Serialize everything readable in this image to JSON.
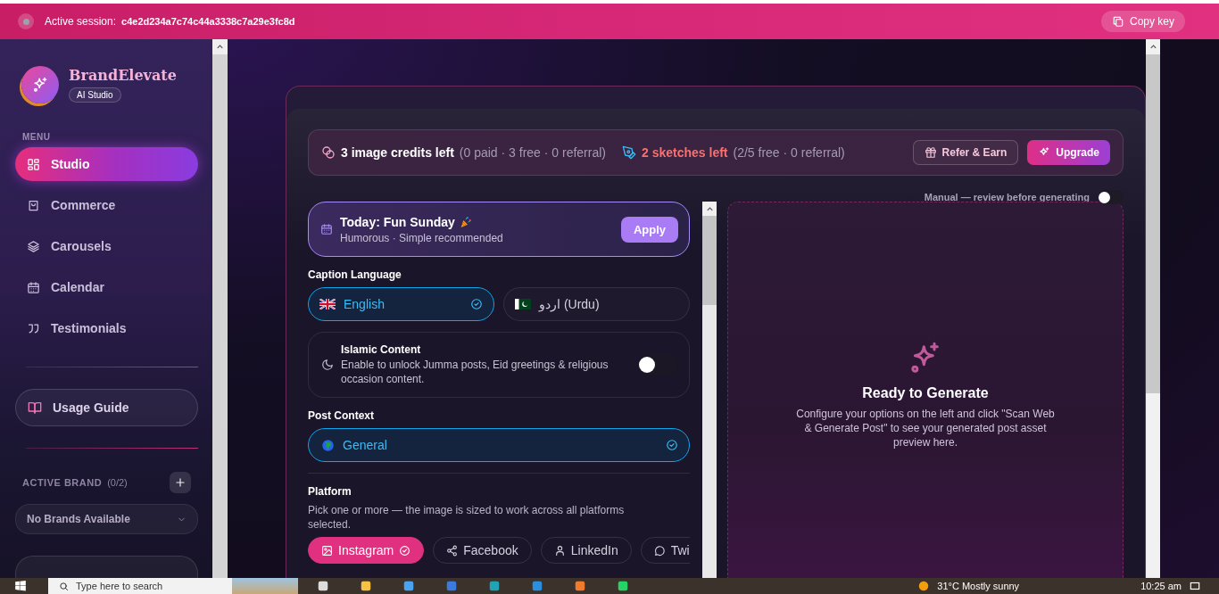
{
  "session_bar": {
    "label": "Active session:",
    "session_id": "c4e2d234a7c74c44a3338c7a29e3fc8d",
    "copy_button": "Copy key"
  },
  "sidebar": {
    "brand": {
      "name": "BrandElevate",
      "badge": "AI Studio"
    },
    "menu_heading": "MENU",
    "items": [
      {
        "label": "Studio",
        "selected": true
      },
      {
        "label": "Commerce",
        "selected": false
      },
      {
        "label": "Carousels",
        "selected": false
      },
      {
        "label": "Calendar",
        "selected": false
      },
      {
        "label": "Testimonials",
        "selected": false
      }
    ],
    "usage_guide": "Usage Guide",
    "active_brand": {
      "heading": "ACTIVE BRAND",
      "count": "(0/2)",
      "dropdown": "No Brands Available"
    }
  },
  "credits": {
    "image_credits": "3 image credits left",
    "image_detail": "(0 paid · 3 free · 0 referral)",
    "sketches": "2 sketches left",
    "sketch_detail": "(2/5 free · 0 referral)",
    "buttons": [
      {
        "label": "Refer & Earn",
        "kind": "outline"
      },
      {
        "label": "Upgrade",
        "kind": "primary"
      }
    ]
  },
  "manual_toggle": {
    "label": "Manual — review before generating",
    "on": false
  },
  "today": {
    "title": "Today: Fun Sunday",
    "subtitle": "Humorous · Simple recommended",
    "button": "Apply"
  },
  "caption_language": {
    "label": "Caption Language",
    "options": [
      {
        "label": "English",
        "selected": true
      },
      {
        "label": "اردو (Urdu)",
        "selected": false
      }
    ]
  },
  "islamic": {
    "title": "Islamic Content",
    "description": "Enable to unlock Jumma posts, Eid greetings & religious occasion content.",
    "on": false
  },
  "post_context": {
    "label": "Post Context",
    "options": [
      {
        "label": "General",
        "selected": true
      }
    ]
  },
  "platform": {
    "label": "Platform",
    "description": "Pick one or more — the image is sized to work across all platforms selected.",
    "options": [
      {
        "label": "Instagram",
        "selected": true
      },
      {
        "label": "Facebook",
        "selected": false
      },
      {
        "label": "LinkedIn",
        "selected": false
      },
      {
        "label": "Twi",
        "selected": false
      }
    ]
  },
  "preview": {
    "title": "Ready to Generate",
    "description": "Configure your options on the left and click \"Scan Web & Generate Post\" to see your generated post asset preview here."
  },
  "taskbar": {
    "search_placeholder": "Type here to search",
    "weather": "31°C  Mostly sunny",
    "time": "10:25 am"
  }
}
